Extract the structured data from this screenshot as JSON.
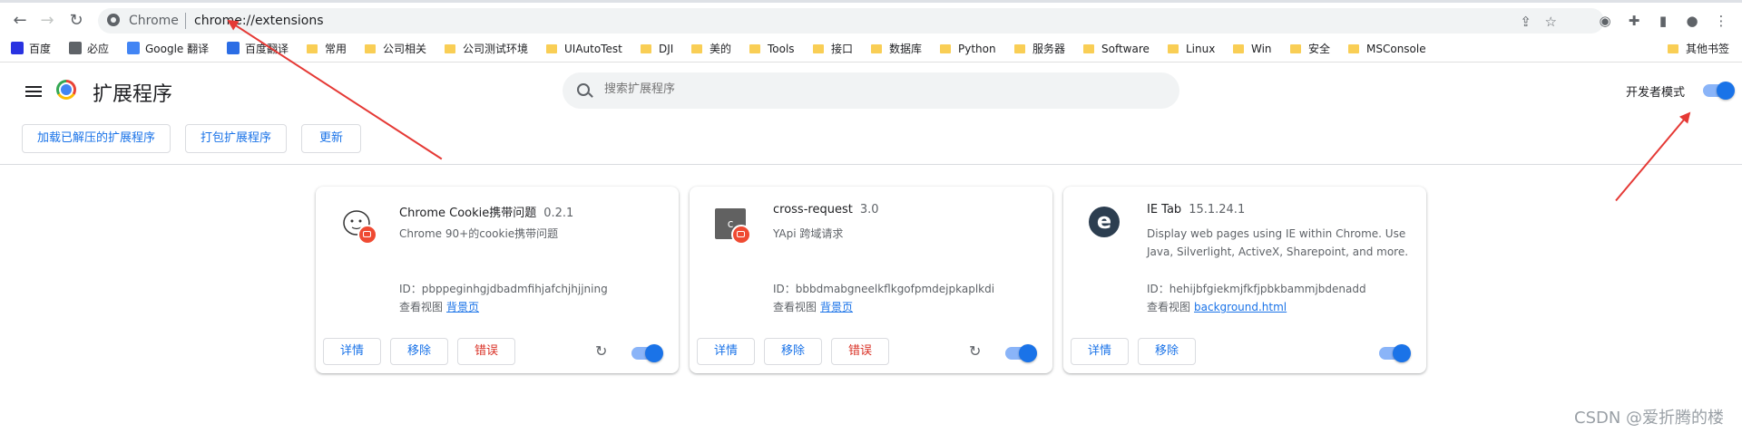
{
  "omnibox": {
    "site": "Chrome",
    "url": "chrome://extensions"
  },
  "bookmarks": [
    {
      "label": "百度",
      "icon": "baidu-icon"
    },
    {
      "label": "必应",
      "icon": "search-icon"
    },
    {
      "label": "Google 翻译",
      "icon": "google-translate-icon"
    },
    {
      "label": "百度翻译",
      "icon": "baidu-translate-icon"
    },
    {
      "label": "常用",
      "icon": "folder-icon"
    },
    {
      "label": "公司相关",
      "icon": "folder-icon"
    },
    {
      "label": "公司测试环境",
      "icon": "folder-icon"
    },
    {
      "label": "UIAutoTest",
      "icon": "folder-icon"
    },
    {
      "label": "DJI",
      "icon": "folder-icon"
    },
    {
      "label": "美的",
      "icon": "folder-icon"
    },
    {
      "label": "Tools",
      "icon": "folder-icon"
    },
    {
      "label": "接口",
      "icon": "folder-icon"
    },
    {
      "label": "数据库",
      "icon": "folder-icon"
    },
    {
      "label": "Python",
      "icon": "folder-icon"
    },
    {
      "label": "服务器",
      "icon": "folder-icon"
    },
    {
      "label": "Software",
      "icon": "folder-icon"
    },
    {
      "label": "Linux",
      "icon": "folder-icon"
    },
    {
      "label": "Win",
      "icon": "folder-icon"
    },
    {
      "label": "安全",
      "icon": "folder-icon"
    },
    {
      "label": "MSConsole",
      "icon": "folder-icon"
    }
  ],
  "other_bookmarks": "其他书签",
  "header": {
    "title": "扩展程序",
    "search_placeholder": "搜索扩展程序",
    "dev_mode_label": "开发者模式",
    "buttons": {
      "load_unpacked": "加载已解压的扩展程序",
      "pack": "打包扩展程序",
      "update": "更新"
    }
  },
  "cards": [
    {
      "name": "Chrome Cookie携带问题",
      "version": "0.2.1",
      "description": "Chrome 90+的cookie携带问题",
      "id_label": "ID：",
      "id": "pbppeginhgjdbadmfihjafchjhjjning",
      "views_label": "查看视图",
      "view_link": "背景页",
      "details": "详情",
      "remove": "移除",
      "errors": "错误"
    },
    {
      "name": "cross-request",
      "version": "3.0",
      "description": "YApi 跨域请求",
      "icon_letter": "c",
      "id_label": "ID：",
      "id": "bbbdmabgneelkflkgofpmdejpkaplkdi",
      "views_label": "查看视图",
      "view_link": "背景页",
      "details": "详情",
      "remove": "移除",
      "errors": "错误"
    },
    {
      "name": "IE Tab",
      "version": "15.1.24.1",
      "description": "Display web pages using IE within Chrome. Use Java, Silverlight, ActiveX, Sharepoint, and more.",
      "icon_letter": "e",
      "id_label": "ID：",
      "id": "hehijbfgiekmjfkfjpbkbammjbdenadd",
      "views_label": "查看视图",
      "view_link": "background.html",
      "details": "详情",
      "remove": "移除"
    }
  ],
  "watermark": "CSDN @爱折腾的楼",
  "colors": {
    "accent": "#1a73e8",
    "error": "#d93025",
    "annotation_arrow": "#e53935"
  }
}
